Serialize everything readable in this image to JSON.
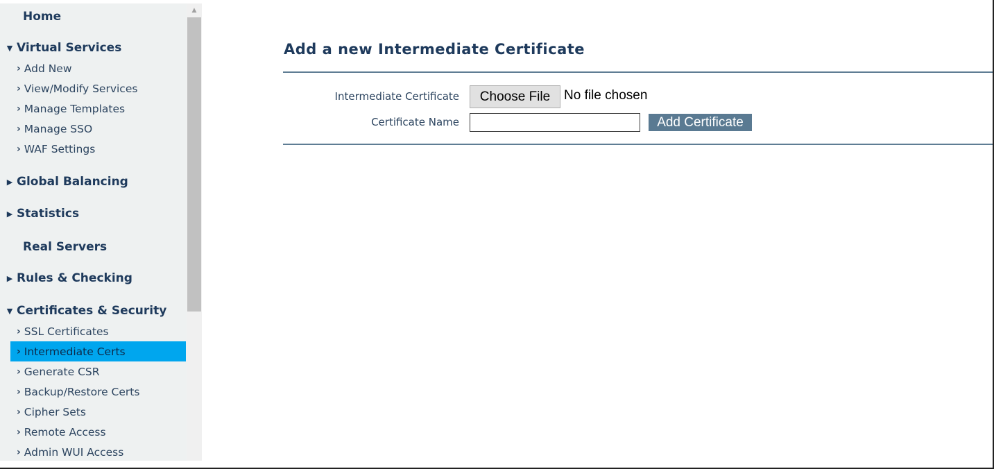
{
  "sidebar": {
    "home": "Home",
    "virtual_services": {
      "label": "Virtual Services",
      "items": [
        "Add New",
        "View/Modify Services",
        "Manage Templates",
        "Manage SSO",
        "WAF Settings"
      ]
    },
    "global_balancing": "Global Balancing",
    "statistics": "Statistics",
    "real_servers": "Real Servers",
    "rules_checking": "Rules & Checking",
    "certificates_security": {
      "label": "Certificates & Security",
      "items": [
        "SSL Certificates",
        "Intermediate Certs",
        "Generate CSR",
        "Backup/Restore Certs",
        "Cipher Sets",
        "Remote Access",
        "Admin WUI Access"
      ],
      "active_index": 1
    },
    "expanded_icon": "caret-down-icon",
    "collapsed_icon": "caret-right-icon",
    "item_icon": "chevron-right-icon"
  },
  "main": {
    "title": "Add a new Intermediate Certificate",
    "form": {
      "certificate_label": "Intermediate Certificate",
      "choose_file_label": "Choose File",
      "file_status": "No file chosen",
      "name_label": "Certificate Name",
      "name_value": "",
      "add_button_label": "Add Certificate"
    }
  },
  "colors": {
    "active_item": "#00a6ee",
    "nav_text": "#1e3a5c",
    "add_button": "#5a7a92",
    "rule": "#5f7d94",
    "sidebar_bg": "#eef1f1"
  }
}
